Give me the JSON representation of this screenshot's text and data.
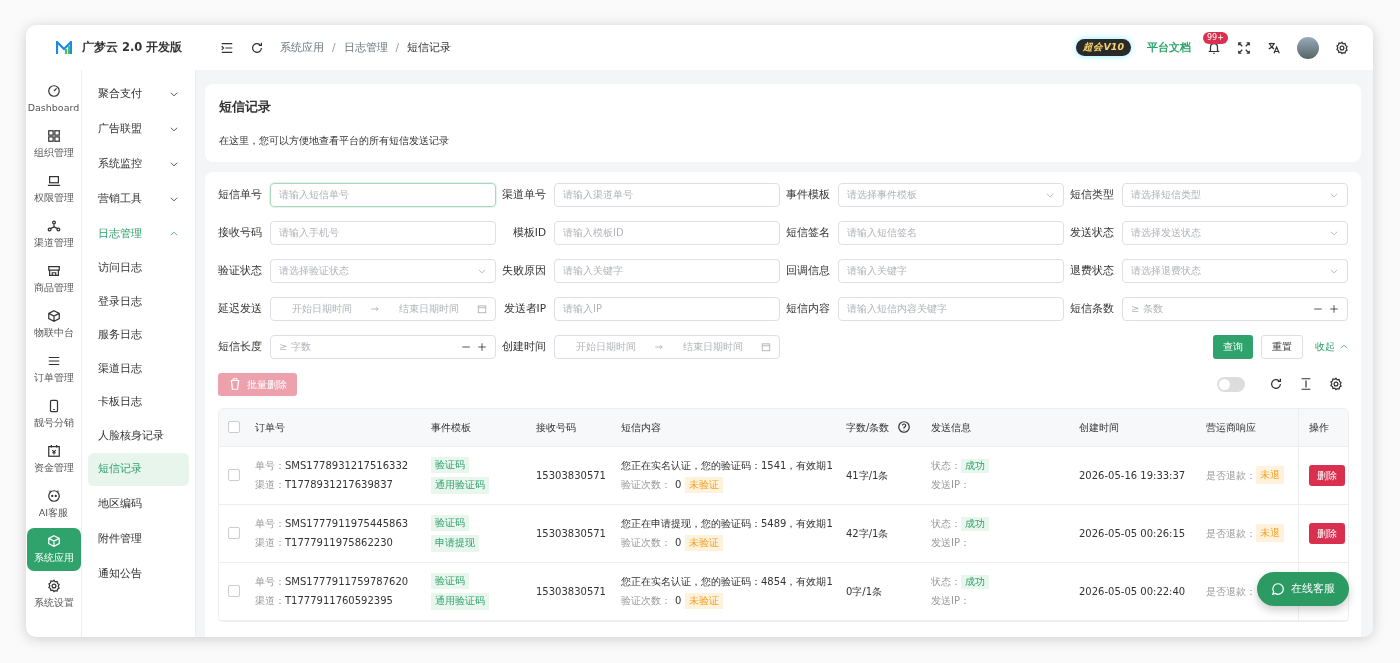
{
  "app": {
    "title": "广梦云 2.0 开发版"
  },
  "header": {
    "breadcrumb": [
      "系统应用",
      "日志管理",
      "短信记录"
    ],
    "breadcrumb_separator": "/",
    "vip_badge": "超会V10",
    "docs_link": "平台文档",
    "notification_count": "99+"
  },
  "rail": [
    {
      "label": "Dashboard",
      "selected": false
    },
    {
      "label": "组织管理",
      "selected": false
    },
    {
      "label": "权限管理",
      "selected": false
    },
    {
      "label": "渠道管理",
      "selected": false
    },
    {
      "label": "商品管理",
      "selected": false
    },
    {
      "label": "物联中台",
      "selected": false
    },
    {
      "label": "订单管理",
      "selected": false
    },
    {
      "label": "靓号分销",
      "selected": false
    },
    {
      "label": "资金管理",
      "selected": false
    },
    {
      "label": "AI客服",
      "selected": false
    },
    {
      "label": "系统应用",
      "selected": true
    },
    {
      "label": "系统设置",
      "selected": false
    }
  ],
  "submenu": [
    {
      "label": "聚合支付",
      "expanded": false,
      "selected": false
    },
    {
      "label": "广告联盟",
      "expanded": false,
      "selected": false
    },
    {
      "label": "系统监控",
      "expanded": false,
      "selected": false
    },
    {
      "label": "营销工具",
      "expanded": false,
      "selected": false
    },
    {
      "label": "日志管理",
      "expanded": true,
      "selected": false,
      "children": [
        {
          "label": "访问日志",
          "selected": false
        },
        {
          "label": "登录日志",
          "selected": false
        },
        {
          "label": "服务日志",
          "selected": false
        },
        {
          "label": "渠道日志",
          "selected": false
        },
        {
          "label": "卡板日志",
          "selected": false
        },
        {
          "label": "人脸核身记录",
          "selected": false
        },
        {
          "label": "短信记录",
          "selected": true
        }
      ]
    },
    {
      "label": "地区编码",
      "selected": false
    },
    {
      "label": "附件管理",
      "selected": false
    },
    {
      "label": "通知公告",
      "selected": false
    }
  ],
  "intro": {
    "title": "短信记录",
    "description": "在这里，您可以方便地查看平台的所有短信发送记录"
  },
  "filters": [
    {
      "label": "短信单号",
      "kind": "input",
      "placeholder": "请输入短信单号",
      "focused": true
    },
    {
      "label": "渠道单号",
      "kind": "input",
      "placeholder": "请输入渠道单号",
      "focused": false
    },
    {
      "label": "事件模板",
      "kind": "select",
      "placeholder": "请选择事件模板",
      "focused": false
    },
    {
      "label": "短信类型",
      "kind": "select",
      "placeholder": "请选择短信类型",
      "focused": false
    },
    {
      "label": "接收号码",
      "kind": "input",
      "placeholder": "请输入手机号",
      "focused": false
    },
    {
      "label": "模板ID",
      "kind": "input",
      "placeholder": "请输入模板ID",
      "focused": false
    },
    {
      "label": "短信签名",
      "kind": "input",
      "placeholder": "请输入短信签名",
      "focused": false
    },
    {
      "label": "发送状态",
      "kind": "select",
      "placeholder": "请选择发送状态",
      "focused": false
    },
    {
      "label": "验证状态",
      "kind": "select",
      "placeholder": "请选择验证状态",
      "focused": false
    },
    {
      "label": "失败原因",
      "kind": "input",
      "placeholder": "请输入关键字",
      "focused": false
    },
    {
      "label": "回调信息",
      "kind": "input",
      "placeholder": "请输入关键字",
      "focused": false
    },
    {
      "label": "退费状态",
      "kind": "select",
      "placeholder": "请选择退费状态",
      "focused": false
    },
    {
      "label": "延迟发送",
      "kind": "daterange",
      "placeholder": "开始日期时间",
      "placeholder_end": "结束日期时间",
      "focused": false
    },
    {
      "label": "发送者IP",
      "kind": "input",
      "placeholder": "请输入IP",
      "focused": false
    },
    {
      "label": "短信内容",
      "kind": "input",
      "placeholder": "请输入短信内容关键字",
      "focused": false
    },
    {
      "label": "短信条数",
      "kind": "number",
      "placeholder": "≥ 条数",
      "focused": false
    },
    {
      "label": "短信长度",
      "kind": "number",
      "placeholder": "≥ 字数",
      "focused": false
    },
    {
      "label": "创建时间",
      "kind": "daterange",
      "placeholder": "开始日期时间",
      "placeholder_end": "结束日期时间",
      "focused": false
    }
  ],
  "filter_actions": {
    "search": "查询",
    "reset": "重置",
    "collapse": "收起"
  },
  "toolbar": {
    "batch_delete": "批量删除",
    "switch_on": false
  },
  "table": {
    "select_all": false,
    "columns": [
      "订单号",
      "事件模板",
      "接收号码",
      "短信内容",
      "字数/条数",
      "发送信息",
      "创建时间",
      "营运商响应",
      "操作"
    ],
    "rows": [
      {
        "selected": false,
        "order_label": "单号：",
        "order_no": "SMS1778931217516332",
        "channel_label": "渠道：",
        "channel_no": "T1778931217639837",
        "tags": [
          "验证码",
          "通用验证码"
        ],
        "phone": "15303830571",
        "content": "您正在实名认证，您的验证码：1541，有效期1",
        "verify_label": "验证次数：",
        "verify_count": "0",
        "verify_status": "未验证",
        "length": "41字/1条",
        "status_label": "状态：",
        "status": "成功",
        "ip_label": "发送IP：",
        "created": "2026-05-16 19:33:37",
        "refund_label": "是否退款：",
        "refund": "未退",
        "action": "删除"
      },
      {
        "selected": false,
        "order_label": "单号：",
        "order_no": "SMS1777911975445863",
        "channel_label": "渠道：",
        "channel_no": "T1777911975862230",
        "tags": [
          "验证码",
          "申请提现"
        ],
        "phone": "15303830571",
        "content": "您正在申请提现，您的验证码：5489，有效期1",
        "verify_label": "验证次数：",
        "verify_count": "0",
        "verify_status": "未验证",
        "length": "42字/1条",
        "status_label": "状态：",
        "status": "成功",
        "ip_label": "发送IP：",
        "created": "2026-05-05 00:26:15",
        "refund_label": "是否退款：",
        "refund": "未退",
        "action": "删除"
      },
      {
        "selected": false,
        "order_label": "单号：",
        "order_no": "SMS1777911759787620",
        "channel_label": "渠道：",
        "channel_no": "T1777911760592395",
        "tags": [
          "验证码",
          "通用验证码"
        ],
        "phone": "15303830571",
        "content": "您正在实名认证，您的验证码：4854，有效期1",
        "verify_label": "验证次数：",
        "verify_count": "0",
        "verify_status": "未验证",
        "length": "0字/1条",
        "status_label": "状态：",
        "status": "成功",
        "ip_label": "发送IP：",
        "created": "2026-05-05 00:22:40",
        "refund_label": "是否退款："
      }
    ]
  },
  "chat_button": "在线客服"
}
